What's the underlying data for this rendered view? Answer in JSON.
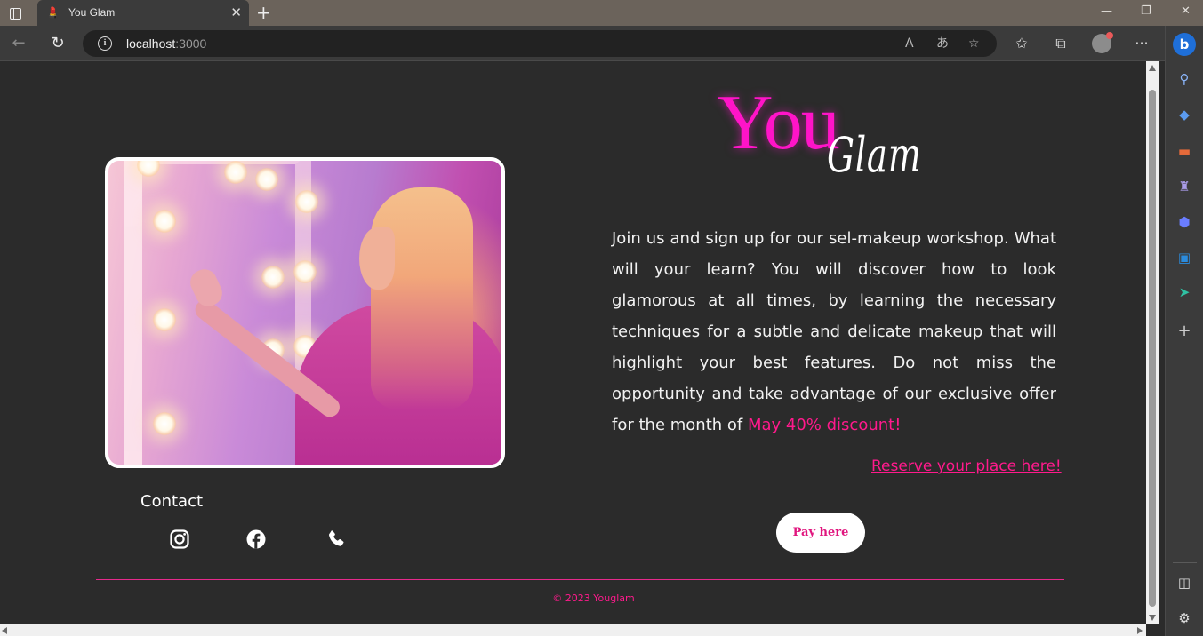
{
  "browser": {
    "tab_title": "You Glam",
    "tab_close": "✕",
    "new_tab": "+",
    "url_host": "localhost",
    "url_port": ":3000",
    "window_controls": {
      "minimize": "—",
      "restore": "❐",
      "close": "✕"
    },
    "more_menu": "···"
  },
  "brand": {
    "you": "You",
    "glam": "Glam",
    "accent_color": "#ff14c8"
  },
  "hero": {
    "image_alt": "Woman applying makeup in front of a lit vanity mirror"
  },
  "description": {
    "text": "Join us and sign up for our sel-makeup workshop. What will your learn? You will discover how to look glamorous at all times, by learning the necessary techniques for a subtle and delicate makeup that will highlight your best features. Do not miss the opportunity and take advantage of our exclusive offer for the month of ",
    "highlight": "May 40% discount!"
  },
  "cta": {
    "reserve_link": "Reserve your place here!",
    "pay_button": "Pay here"
  },
  "contact": {
    "title": "Contact",
    "icons": [
      "instagram-icon",
      "facebook-icon",
      "phone-icon"
    ]
  },
  "footer": {
    "copyright": "© 2023 Youglam"
  },
  "colors": {
    "background": "#2b2b2b",
    "accent_pink": "#ff1a8c",
    "text": "#f2f2f2"
  }
}
